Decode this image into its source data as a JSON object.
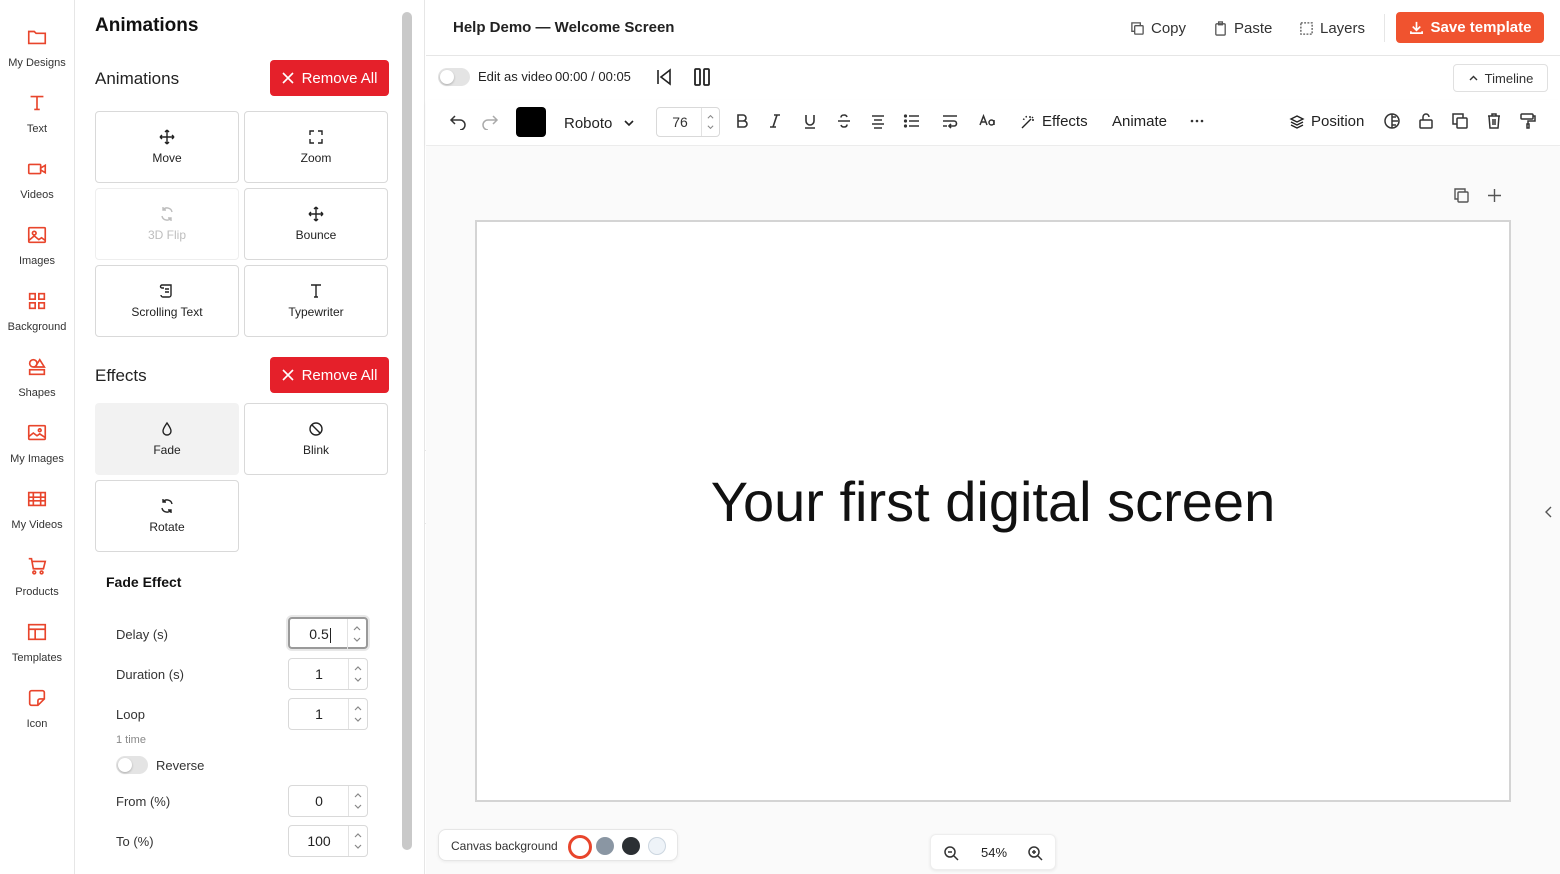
{
  "colors": {
    "accent": "#e8452c",
    "remove": "#e5202a",
    "save": "#f0532f"
  },
  "rail": [
    {
      "label": "My Designs",
      "icon": "folder-icon"
    },
    {
      "label": "Text",
      "icon": "text-icon"
    },
    {
      "label": "Videos",
      "icon": "video-camera-icon"
    },
    {
      "label": "Images",
      "icon": "image-icon"
    },
    {
      "label": "Background",
      "icon": "grid-icon"
    },
    {
      "label": "Shapes",
      "icon": "shapes-icon"
    },
    {
      "label": "My Images",
      "icon": "images-stack-icon"
    },
    {
      "label": "My Videos",
      "icon": "film-icon"
    },
    {
      "label": "Products",
      "icon": "cart-icon"
    },
    {
      "label": "Templates",
      "icon": "template-icon"
    },
    {
      "label": "Icon",
      "icon": "sticker-icon"
    }
  ],
  "panel": {
    "title": "Animations",
    "animations": {
      "title": "Animations",
      "remove_all": "Remove All",
      "tiles": [
        {
          "label": "Move",
          "icon": "move-icon",
          "disabled": false
        },
        {
          "label": "Zoom",
          "icon": "zoom-icon",
          "disabled": false
        },
        {
          "label": "3D Flip",
          "icon": "flip-icon",
          "disabled": true
        },
        {
          "label": "Bounce",
          "icon": "bounce-icon",
          "disabled": false
        },
        {
          "label": "Scrolling Text",
          "icon": "scroll-icon",
          "disabled": false
        },
        {
          "label": "Typewriter",
          "icon": "typewriter-icon",
          "disabled": false
        }
      ]
    },
    "effects": {
      "title": "Effects",
      "remove_all": "Remove All",
      "tiles": [
        {
          "label": "Fade",
          "icon": "drop-icon",
          "selected": true
        },
        {
          "label": "Blink",
          "icon": "blink-icon",
          "selected": false
        },
        {
          "label": "Rotate",
          "icon": "rotate-icon",
          "selected": false
        }
      ]
    },
    "fade": {
      "title": "Fade Effect",
      "delay_label": "Delay (s)",
      "delay_value": "0.5",
      "duration_label": "Duration (s)",
      "duration_value": "1",
      "loop_label": "Loop",
      "loop_value": "1",
      "loop_note": "1 time",
      "reverse_label": "Reverse",
      "reverse_on": false,
      "from_label": "From (%)",
      "from_value": "0",
      "to_label": "To (%)",
      "to_value": "100"
    }
  },
  "topbar": {
    "title": "Help Demo — Welcome Screen",
    "copy": "Copy",
    "paste": "Paste",
    "layers": "Layers",
    "save": "Save template"
  },
  "videorow": {
    "edit_label": "Edit as video",
    "time": "00:00 / 00:05",
    "timeline": "Timeline"
  },
  "fmt": {
    "font": "Roboto",
    "size": "76",
    "text_color": "#000000",
    "effects": "Effects",
    "animate": "Animate",
    "position": "Position"
  },
  "canvas": {
    "text": "Your first digital screen",
    "bg_label": "Canvas background",
    "bg_colors": [
      "#ffffff",
      "#8a96a3",
      "#2b2f33",
      "#eef3f8"
    ],
    "zoom": "54%"
  }
}
